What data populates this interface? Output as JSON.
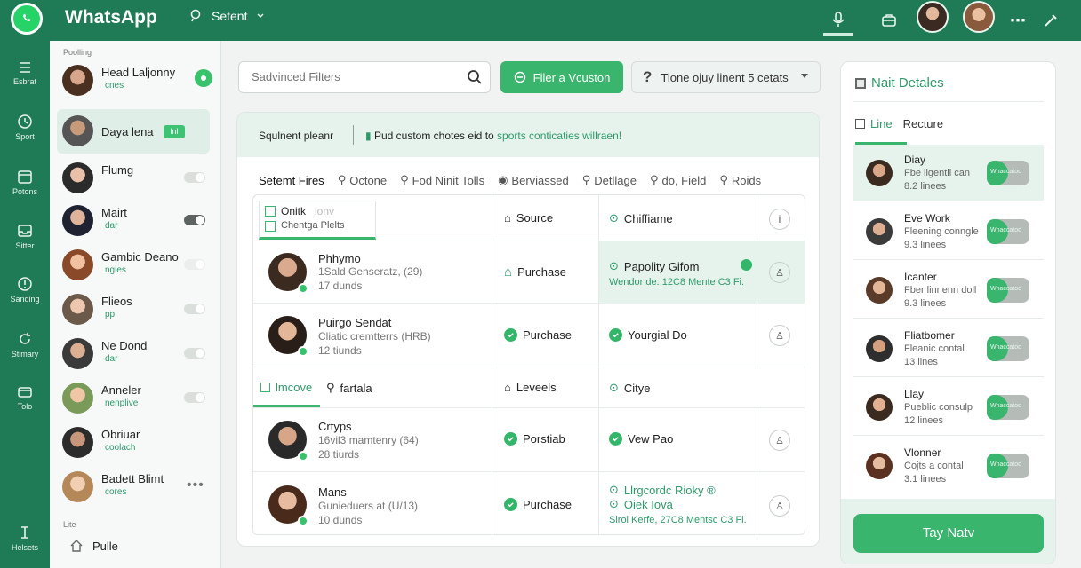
{
  "app": {
    "title": "WhatsApp",
    "search_label": "Setent"
  },
  "rail": {
    "items": [
      "Esbrat",
      "Sport",
      "Potons",
      "Sitter",
      "Sanding",
      "Stimary",
      "Tolo",
      "Helsets"
    ]
  },
  "chatlist": {
    "section_top": "Poolling",
    "section_bottom": "Lite",
    "chats": [
      {
        "name": "Head Laljonny",
        "sub": "cnes"
      },
      {
        "name": "Daya lena",
        "sub": "",
        "tag": "lnl"
      },
      {
        "name": "Flumg",
        "sub": ""
      },
      {
        "name": "Mairt",
        "sub": "dar"
      },
      {
        "name": "Gambic Deano",
        "sub": "ngies"
      },
      {
        "name": "Flieos",
        "sub": "pp"
      },
      {
        "name": "Ne Dond",
        "sub": "dar"
      },
      {
        "name": "Anneler",
        "sub": "nenplive"
      },
      {
        "name": "Obriuar",
        "sub": "coolach"
      },
      {
        "name": "Badett Blimt",
        "sub": "cores"
      }
    ],
    "bottom_item": "Pulle"
  },
  "filters": {
    "search_placeholder": "Sadvinced Filters",
    "button_label": "Filer a Vcuston",
    "dropdown_label": "Tione ojuy linent 5 cetats"
  },
  "banner": {
    "label": "Squlnent pleanr",
    "message_prefix": "Pud custom chotes eid to",
    "message_highlight": "sports conticaties willraen!"
  },
  "tabs": [
    "Setemt Fires",
    "Octone",
    "Fod Ninit Tolls",
    "Berviassed",
    "Detllage",
    "do, Field",
    "Roids"
  ],
  "table": {
    "header": {
      "box_title": "Onitk",
      "box_title_muted": "lonv",
      "box_sub": "Chentga Plelts",
      "col2": "Source",
      "col3": "Chiffiame"
    },
    "rows": [
      {
        "name": "Phhymo",
        "meta": "1Sald Genseratz, (29)",
        "sub": "17 dunds",
        "status": "Purchase",
        "detail": "Papolity Gifom",
        "note": "Wendor de: 12C8 Mente C3 Fi."
      },
      {
        "name": "Puirgo Sendat",
        "meta": "Cliatic cremtterrs (HRB)",
        "sub": "12 tiunds",
        "status": "Purchase",
        "detail": "Yourgial Do"
      }
    ],
    "group": {
      "label": "lmcove",
      "col1b": "fartala",
      "col2": "Leveels",
      "col3": "Citye"
    },
    "rows2": [
      {
        "name": "Crtyps",
        "meta": "16vil3 mamtenry (64)",
        "sub": "28 tiurds",
        "status": "Porstiab",
        "detail": "Vew Pao"
      },
      {
        "name": "Mans",
        "meta": "Gunieduers at (U/13)",
        "sub": "10 dunds",
        "status": "Purchase",
        "detail": "Llrgcordc Rioky ®",
        "detail2": "Oiek Iova",
        "note": "Slrol Kerfe, 27C8 Mentsc C3 Fl."
      }
    ]
  },
  "right_panel": {
    "title": "Nait Detales",
    "tabs": [
      "Line",
      "Recture"
    ],
    "items": [
      {
        "name": "Diay",
        "desc": "Fbe ilgentll can",
        "lines": "8.2 linees",
        "pill": "Wnaccatoo"
      },
      {
        "name": "Eve Work",
        "desc": "Fleening conngle",
        "lines": "9.3 linees",
        "pill": "Wnaccatoo"
      },
      {
        "name": "Icanter",
        "desc": "Fber linnenn doll",
        "lines": "9.3 linees",
        "pill": "Wnaccatoo"
      },
      {
        "name": "Fliatbomer",
        "desc": "Fleanic contal",
        "lines": "13 lines",
        "pill": "Wnaccatoo"
      },
      {
        "name": "Llay",
        "desc": "Pueblic consulp",
        "lines": "12 linees",
        "pill": "Wnaccatoo"
      },
      {
        "name": "Vlonner",
        "desc": "Cojts a contal",
        "lines": "3.1 linees",
        "pill": "Wnaccatoo"
      }
    ],
    "cta": "Tay Natv"
  },
  "colors": {
    "brand": "#1f7a56",
    "accent": "#39b56e",
    "highlight": "#e6f3ec"
  }
}
